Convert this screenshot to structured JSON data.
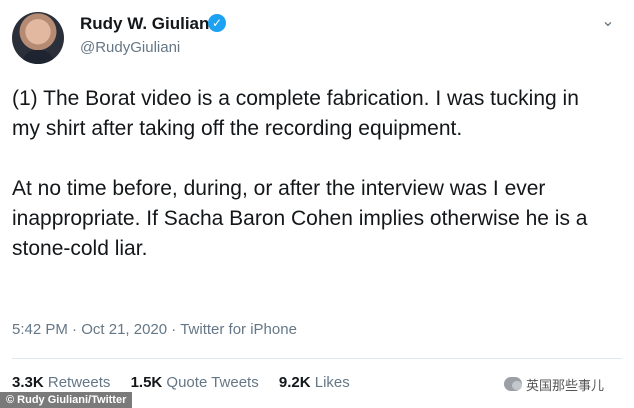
{
  "tweet": {
    "author": {
      "display_name": "Rudy W. Giuliani",
      "handle": "@RudyGiuliani",
      "verified_icon": "verified-badge-icon",
      "verified_glyph": "✓"
    },
    "menu_icon": "chevron-down-icon",
    "menu_glyph": "⌄",
    "paragraphs": [
      "(1) The Borat video is a complete fabrication. I was tucking in my shirt after taking off the recording equipment.",
      "At no time before, during, or after the interview was I ever inappropriate. If Sacha Baron Cohen implies otherwise he is a stone-cold liar."
    ],
    "time": "5:42 PM",
    "separator": "·",
    "date": "Oct 21, 2020",
    "source": "Twitter for iPhone",
    "stats": {
      "retweets_count": "3.3K",
      "retweets_label": "Retweets",
      "quotes_count": "1.5K",
      "quotes_label": "Quote Tweets",
      "likes_count": "9.2K",
      "likes_label": "Likes"
    }
  },
  "overlay": {
    "credit": "© Rudy Giuliani/Twitter",
    "watermark": "英国那些事儿",
    "watermark_icon": "wechat-icon"
  },
  "colors": {
    "verified": "#1da1f2",
    "secondary_text": "#657786",
    "primary_text": "#14171a"
  }
}
